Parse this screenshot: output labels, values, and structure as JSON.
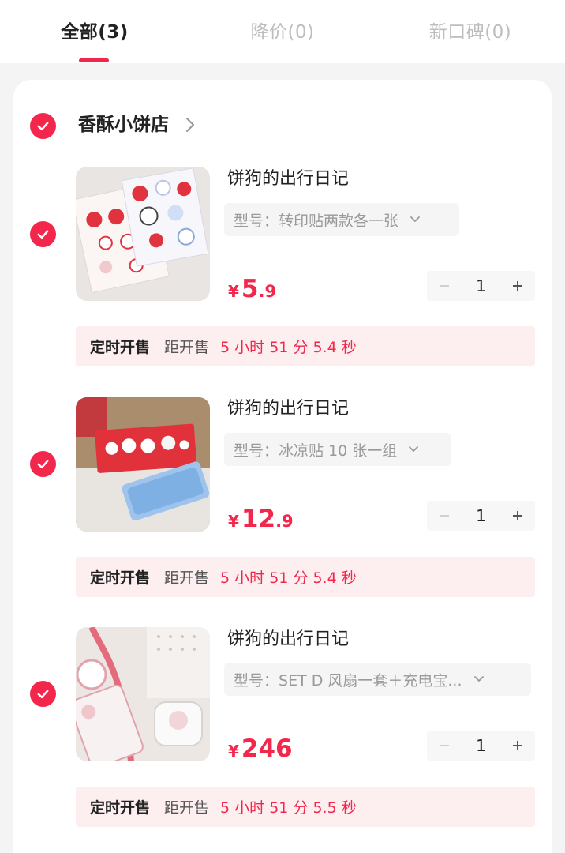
{
  "tabs": [
    {
      "label": "全部(3)",
      "active": true
    },
    {
      "label": "降价(0)",
      "active": false
    },
    {
      "label": "新口碑(0)",
      "active": false
    }
  ],
  "shop": {
    "name": "香酥小饼店",
    "arrow_icon": "chevron-right-icon"
  },
  "accent_color": "#f2274b",
  "items": [
    {
      "title": "饼狗的出行日记",
      "spec_label": "型号：",
      "spec_value": "转印贴两款各一张",
      "currency": "¥",
      "price_int": "5",
      "price_dec": ".9",
      "quantity": "1",
      "minus": "−",
      "plus": "+",
      "timer_tag": "定时开售",
      "timer_label": "距开售",
      "timer_countdown": "5 小时 51 分 5.4 秒",
      "checked": true
    },
    {
      "title": "饼狗的出行日记",
      "spec_label": "型号：",
      "spec_value": "冰凉贴 10 张一组",
      "currency": "¥",
      "price_int": "12",
      "price_dec": ".9",
      "quantity": "1",
      "minus": "−",
      "plus": "+",
      "timer_tag": "定时开售",
      "timer_label": "距开售",
      "timer_countdown": "5 小时 51 分 5.4 秒",
      "checked": true
    },
    {
      "title": "饼狗的出行日记",
      "spec_label": "型号：",
      "spec_value": "SET D  风扇一套＋充电宝...",
      "currency": "¥",
      "price_int": "246",
      "price_dec": "",
      "quantity": "1",
      "minus": "−",
      "plus": "+",
      "timer_tag": "定时开售",
      "timer_label": "距开售",
      "timer_countdown": "5 小时 51 分 5.5 秒",
      "checked": true
    }
  ]
}
